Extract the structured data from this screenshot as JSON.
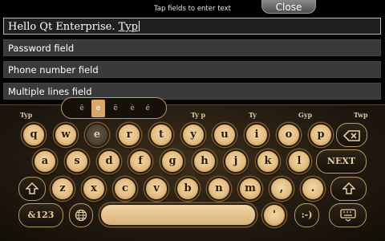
{
  "header": {
    "hint": "Tap fields to enter text",
    "close_label": "Close"
  },
  "fields": {
    "active_text": "Hello Qt Enterprise. ",
    "active_current_word": "Typ",
    "password_placeholder": "Password field",
    "phone_placeholder": "Phone number field",
    "multiline_placeholder": "Multiple lines field"
  },
  "predictions": [
    "Typ",
    "Ty p",
    "Ty",
    "Gyp",
    "Twp"
  ],
  "alternates": [
    "ē",
    "e",
    "ë",
    "è",
    "é"
  ],
  "rows": {
    "row1": [
      "q",
      "w",
      "e",
      "r",
      "t",
      "y",
      "u",
      "i",
      "o",
      "p"
    ],
    "row2": [
      "a",
      "s",
      "d",
      "f",
      "g",
      "h",
      "j",
      "k",
      "l"
    ],
    "row3": [
      "z",
      "x",
      "c",
      "v",
      "b",
      "n",
      "m",
      ",",
      "."
    ]
  },
  "keys": {
    "enter_label": "NEXT",
    "symbols_label": "&123",
    "apostrophe_label": "'",
    "smiley_label": ":-)",
    "backspace_icon": "backspace-icon",
    "shift_icon": "shift-arrow-icon",
    "globe_icon": "globe-icon",
    "hide_icon": "keyboard-hide-icon"
  },
  "colors": {
    "key_face": "#e3bd82",
    "keyboard_bg": "#211910",
    "accent": "#d8a86a"
  }
}
